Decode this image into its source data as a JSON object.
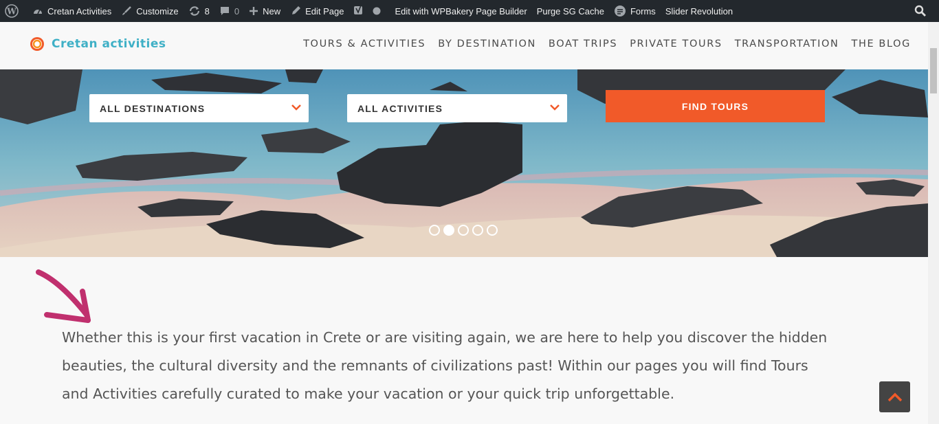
{
  "adminbar": {
    "items": [
      {
        "name": "wp-logo-icon",
        "label": ""
      },
      {
        "name": "site-name",
        "label": "Cretan Activities"
      },
      {
        "name": "customize",
        "label": "Customize"
      },
      {
        "name": "updates",
        "label": "8"
      },
      {
        "name": "comments",
        "label": "0"
      },
      {
        "name": "new",
        "label": "New"
      },
      {
        "name": "edit-page",
        "label": "Edit Page"
      },
      {
        "name": "edit-wpbakery",
        "label": "Edit with WPBakery Page Builder"
      },
      {
        "name": "purge-cache",
        "label": "Purge SG Cache"
      },
      {
        "name": "forms",
        "label": "Forms"
      },
      {
        "name": "slider-revolution",
        "label": "Slider Revolution"
      }
    ]
  },
  "header": {
    "logo_text": "Cretan activities",
    "nav": [
      "TOURS & ACTIVITIES",
      "BY DESTINATION",
      "BOAT TRIPS",
      "PRIVATE TOURS",
      "TRANSPORTATION",
      "THE BLOG"
    ]
  },
  "search": {
    "destination": "ALL DESTINATIONS",
    "activity": "ALL ACTIVITIES",
    "button": "FIND TOURS"
  },
  "slider": {
    "slides": 5,
    "active": 2
  },
  "intro": {
    "line1": "Whether this is your first vacation in Crete or are visiting again, we are here to help you discover the hidden",
    "line2": "beauties, the cultural diversity and the remnants of civilizations past! Within our pages you will find Tours",
    "line3": "and Activities carefully curated to make your vacation or your quick trip unforgettable."
  },
  "colors": {
    "accent": "#f15a29",
    "brand": "#3fb0c6",
    "adminbar": "#23282d",
    "arrow": "#c0306e"
  }
}
